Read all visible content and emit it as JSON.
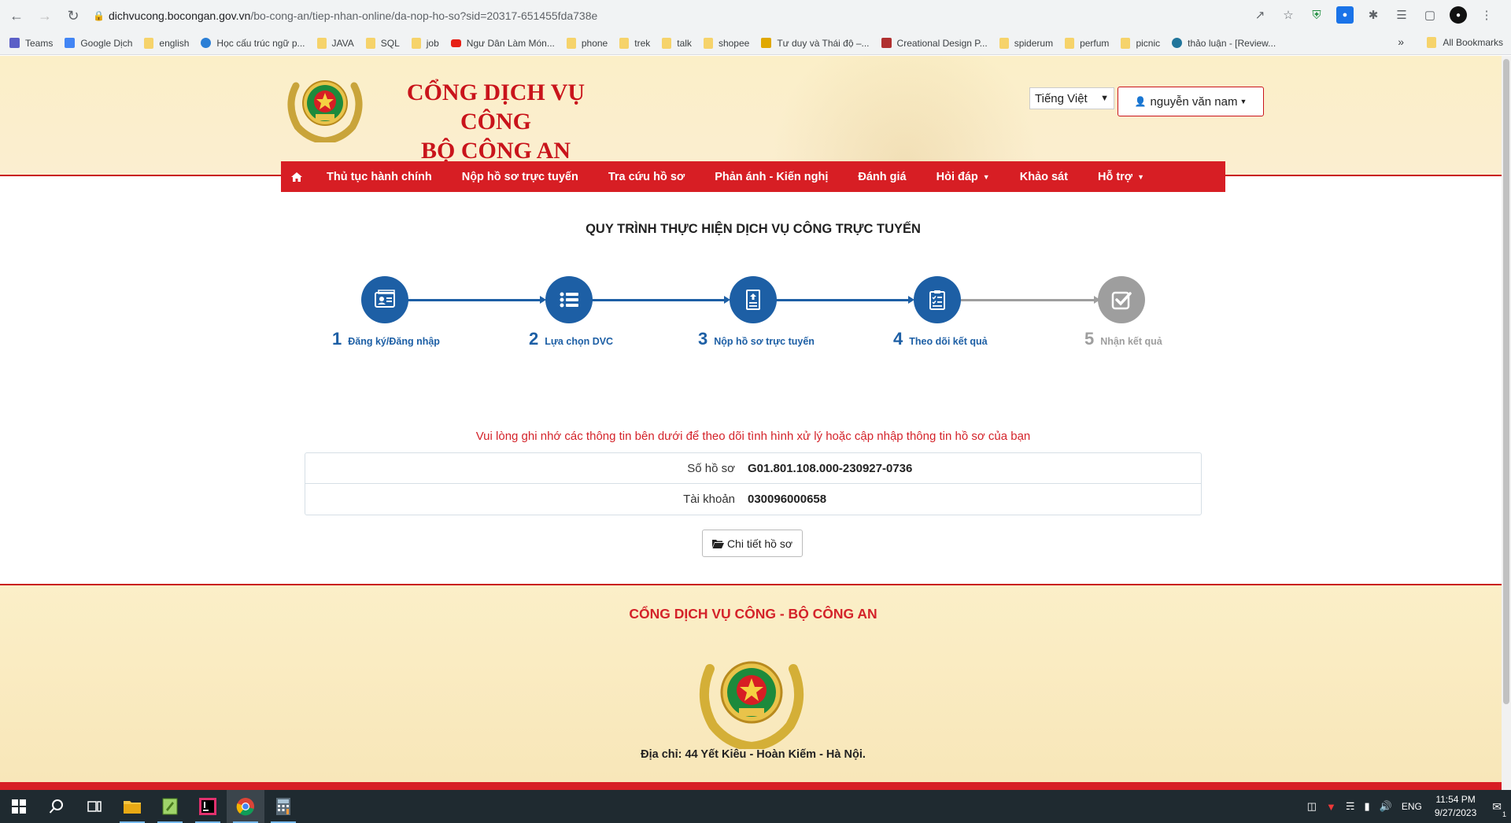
{
  "browser": {
    "url_domain": "dichvucong.bocongan.gov.vn",
    "url_path": "/bo-cong-an/tiep-nhan-online/da-nop-ho-so?sid=20317-651455fda738e",
    "bookmarks": [
      {
        "label": "Teams",
        "icon": "teams-icon"
      },
      {
        "label": "Google Dịch",
        "icon": "translate-icon"
      },
      {
        "label": "english",
        "icon": "folder-icon"
      },
      {
        "label": "Học cấu trúc ngữ p...",
        "icon": "edge-icon"
      },
      {
        "label": "JAVA",
        "icon": "folder-icon"
      },
      {
        "label": "SQL",
        "icon": "folder-icon"
      },
      {
        "label": "job",
        "icon": "folder-icon"
      },
      {
        "label": "Ngư Dân Làm Món...",
        "icon": "youtube-icon"
      },
      {
        "label": "phone",
        "icon": "folder-icon"
      },
      {
        "label": "trek",
        "icon": "folder-icon"
      },
      {
        "label": "talk",
        "icon": "folder-icon"
      },
      {
        "label": "shopee",
        "icon": "folder-icon"
      },
      {
        "label": "Tư duy và Thái độ –...",
        "icon": "site-icon"
      },
      {
        "label": "Creational Design P...",
        "icon": "site-icon"
      },
      {
        "label": "spiderum",
        "icon": "folder-icon"
      },
      {
        "label": "perfum",
        "icon": "folder-icon"
      },
      {
        "label": "picnic",
        "icon": "folder-icon"
      },
      {
        "label": "thảo luận - [Review...",
        "icon": "wordpress-icon"
      }
    ],
    "more_bookmarks": "»",
    "all_bookmarks": "All Bookmarks"
  },
  "header": {
    "title_line1": "CỔNG DỊCH VỤ CÔNG",
    "title_line2": "BỘ CÔNG AN",
    "language": "Tiếng Việt",
    "user_name": "nguyễn văn nam"
  },
  "nav": {
    "items": [
      {
        "label": "Thủ tục hành chính",
        "dropdown": false
      },
      {
        "label": "Nộp hồ sơ trực tuyến",
        "dropdown": false
      },
      {
        "label": "Tra cứu hồ sơ",
        "dropdown": false
      },
      {
        "label": "Phản ánh - Kiến nghị",
        "dropdown": false
      },
      {
        "label": "Đánh giá",
        "dropdown": false
      },
      {
        "label": "Hỏi đáp",
        "dropdown": true
      },
      {
        "label": "Khảo sát",
        "dropdown": false
      },
      {
        "label": "Hỗ trợ",
        "dropdown": true
      }
    ]
  },
  "process": {
    "title": "QUY TRÌNH THỰC HIỆN DỊCH VỤ CÔNG TRỰC TUYẾN",
    "steps": [
      {
        "num": "1",
        "label": "Đăng ký/Đăng nhập",
        "icon": "id-card-icon",
        "active": true
      },
      {
        "num": "2",
        "label": "Lựa chọn DVC",
        "icon": "list-icon",
        "active": true
      },
      {
        "num": "3",
        "label": "Nộp hồ sơ trực tuyến",
        "icon": "upload-document-icon",
        "active": true
      },
      {
        "num": "4",
        "label": "Theo dõi kết quả",
        "icon": "clipboard-checklist-icon",
        "active": true
      },
      {
        "num": "5",
        "label": "Nhận kết quả",
        "icon": "check-square-icon",
        "active": false
      }
    ],
    "active_color": "#1d5fa5",
    "inactive_color": "#9e9e9e"
  },
  "result": {
    "notice": "Vui lòng ghi nhớ các thông tin bên dưới để theo dõi tình hình xử lý hoặc cập nhập thông tin hồ sơ của bạn",
    "rows": [
      {
        "label": "Số hồ sơ",
        "value": "G01.801.108.000-230927-0736"
      },
      {
        "label": "Tài khoản",
        "value": "030096000658"
      }
    ],
    "detail_button": "Chi tiết hồ sơ"
  },
  "footer": {
    "title": "CỔNG DỊCH VỤ CÔNG - BỘ CÔNG AN",
    "address": "Địa chỉ: 44 Yết Kiêu - Hoàn Kiếm - Hà Nội."
  },
  "taskbar": {
    "language": "ENG",
    "time": "11:54 PM",
    "date": "9/27/2023",
    "notifications": "1"
  },
  "colors": {
    "brand_red": "#d71e24",
    "header_bg": "#fbefc8",
    "step_blue": "#1d5fa5"
  }
}
